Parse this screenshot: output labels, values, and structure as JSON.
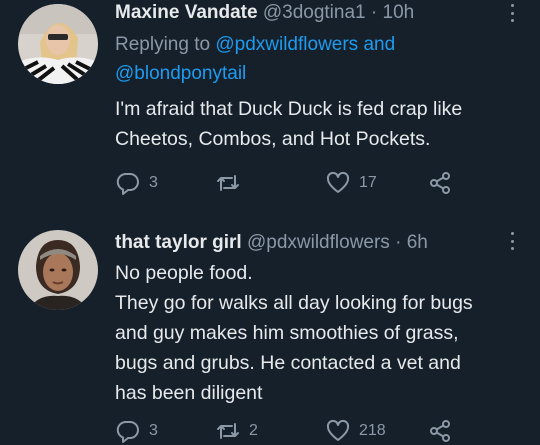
{
  "colors": {
    "background": "#15202b",
    "text": "#e7e9ea",
    "muted": "#8b98a5",
    "link": "#1d9bf0"
  },
  "tweets": [
    {
      "name": "Maxine Vandate",
      "handle": "@3dogtina1",
      "separator": "·",
      "time": "10h",
      "reply_prefix": "Replying to",
      "reply_to_1": "@pdxwildflowers",
      "reply_and": "and",
      "reply_to_2": "@blondponytail",
      "lines": [
        "I'm afraid that Duck Duck is fed crap like",
        "Cheetos, Combos, and Hot Pockets."
      ],
      "reply_count": "3",
      "retweet_count": "",
      "like_count": "17",
      "icons": [
        "reply-icon",
        "retweet-icon",
        "like-icon",
        "share-icon"
      ]
    },
    {
      "name": "that taylor girl",
      "handle": "@pdxwildflowers",
      "separator": "·",
      "time": "6h",
      "lines": [
        "No people food.",
        "They go for walks all day looking for bugs",
        "and guy makes him smoothies of grass,",
        "bugs and grubs. He contacted a vet and",
        "has been diligent"
      ],
      "reply_count": "3",
      "retweet_count": "2",
      "like_count": "218",
      "icons": [
        "reply-icon",
        "retweet-icon",
        "like-icon",
        "share-icon"
      ]
    }
  ]
}
